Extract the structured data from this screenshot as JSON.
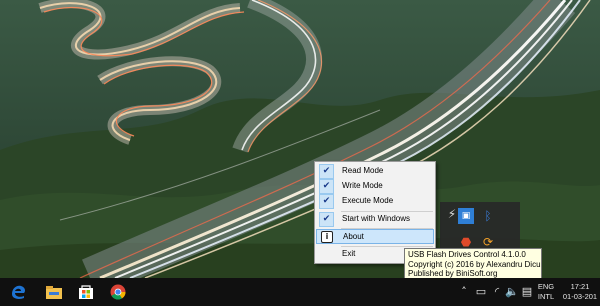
{
  "context_menu": {
    "items": [
      {
        "label": "Read Mode",
        "checked": true
      },
      {
        "label": "Write Mode",
        "checked": true
      },
      {
        "label": "Execute Mode",
        "checked": true
      },
      {
        "label": "Start with Windows",
        "checked": true
      },
      {
        "label": "About",
        "checked": false,
        "icon": "info-icon",
        "highlighted": true
      },
      {
        "label": "Exit",
        "checked": false
      }
    ]
  },
  "tooltip": {
    "line1": "USB Flash Drives Control 4.1.0.0",
    "line2": "Copyright (c) 2016 by Alexandru Dicu",
    "line3": "Published by BiniSoft.org"
  },
  "taskbar": {
    "pinned": [
      "edge-icon",
      "file-explorer-icon",
      "store-icon",
      "chrome-icon"
    ],
    "tray_icons": [
      "chevron-up-icon",
      "network-icon",
      "wifi-icon",
      "volume-icon",
      "action-center-icon"
    ],
    "language_line1": "ENG",
    "language_line2": "INTL",
    "time": "17:21",
    "date": "01-03-201"
  },
  "colors": {
    "taskbar": "#101010",
    "menu_bg": "#f2f2f2",
    "menu_highlight": "#cde6fb",
    "tooltip_bg": "#ffffe1",
    "accent": "#1e73d2"
  }
}
